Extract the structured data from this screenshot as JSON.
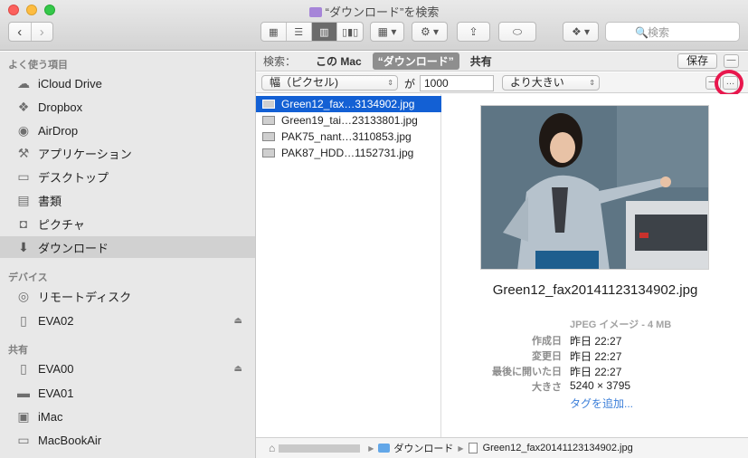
{
  "window": {
    "title": "“ダウンロード”を検索"
  },
  "toolbar": {
    "search_placeholder": "検索",
    "view_modes": [
      "icon-view-icon",
      "list-view-icon",
      "column-view-icon",
      "coverflow-view-icon"
    ],
    "active_view": 2
  },
  "sidebar": {
    "favorites_label": "よく使う項目",
    "favorites": [
      {
        "label": "iCloud Drive",
        "icon": "cloud-icon"
      },
      {
        "label": "Dropbox",
        "icon": "dropbox-icon"
      },
      {
        "label": "AirDrop",
        "icon": "airdrop-icon"
      },
      {
        "label": "アプリケーション",
        "icon": "applications-icon"
      },
      {
        "label": "デスクトップ",
        "icon": "desktop-icon"
      },
      {
        "label": "書類",
        "icon": "documents-icon"
      },
      {
        "label": "ピクチャ",
        "icon": "camera-icon"
      },
      {
        "label": "ダウンロード",
        "icon": "download-icon"
      }
    ],
    "devices_label": "デバイス",
    "devices": [
      {
        "label": "リモートディスク",
        "icon": "disc-icon"
      },
      {
        "label": "EVA02",
        "icon": "drive-icon"
      }
    ],
    "shared_label": "共有",
    "shared": [
      {
        "label": "EVA00",
        "icon": "usb-drive-icon"
      },
      {
        "label": "EVA01",
        "icon": "server-icon"
      },
      {
        "label": "iMac",
        "icon": "imac-icon"
      },
      {
        "label": "MacBookAir",
        "icon": "laptop-icon"
      }
    ]
  },
  "scope": {
    "label": "検索：",
    "this_mac": "この Mac",
    "current": "“ダウンロード”",
    "shared": "共有",
    "save": "保存"
  },
  "criteria": {
    "attribute": "幅（ピクセル)",
    "connector": "が",
    "value": "1000",
    "operator": "より大きい"
  },
  "files": [
    "Green12_fax…3134902.jpg",
    "Green19_tai…23133801.jpg",
    "PAK75_nant…3110853.jpg",
    "PAK87_HDD…1152731.jpg"
  ],
  "preview": {
    "name": "Green12_fax20141123134902.jpg",
    "kind": "JPEG イメージ - 4 MB",
    "created_label": "作成日",
    "created": "昨日 22:27",
    "modified_label": "変更日",
    "modified": "昨日 22:27",
    "opened_label": "最後に開いた日",
    "opened": "昨日 22:27",
    "size_label": "大きさ",
    "size": "5240 × 3795",
    "add_tag": "タグを追加..."
  },
  "pathbar": {
    "folder": "ダウンロード",
    "file": "Green12_fax20141123134902.jpg"
  },
  "colors": {
    "selection": "#1360d4",
    "highlight_ring": "#e8174d",
    "link": "#3c7fd9"
  }
}
